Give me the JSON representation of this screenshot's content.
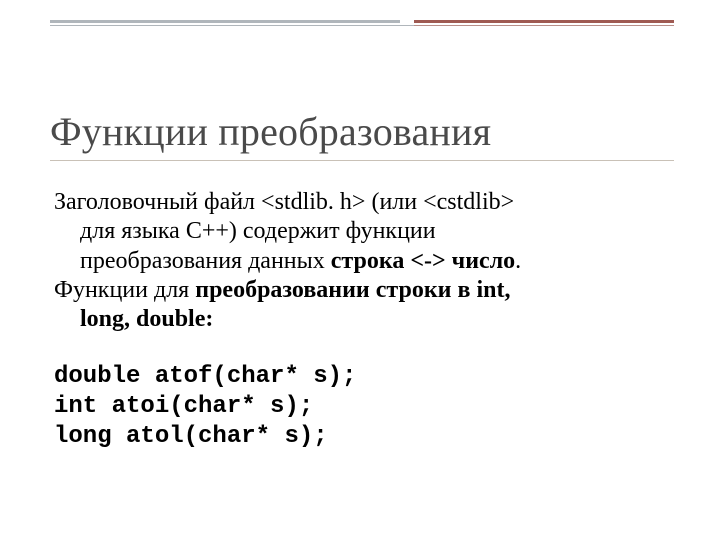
{
  "slide": {
    "title": "Функции преобразования",
    "para1": {
      "l1_a": "Заголовочный файл <stdlib. h> (или <cstdlib>",
      "l2": "для языка C++) содержит функции",
      "l3_a": "преобразования данных ",
      "l3_b": "строка <-> число",
      "l3_c": "."
    },
    "para2": {
      "l1_a": "Функции для ",
      "l1_b": "преобразовании строки в int,",
      "l2": "long, double:"
    },
    "code": {
      "l1": "double atof(char* s);",
      "l2": "int atoi(char* s);",
      "l3": "long atol(char* s);"
    }
  }
}
